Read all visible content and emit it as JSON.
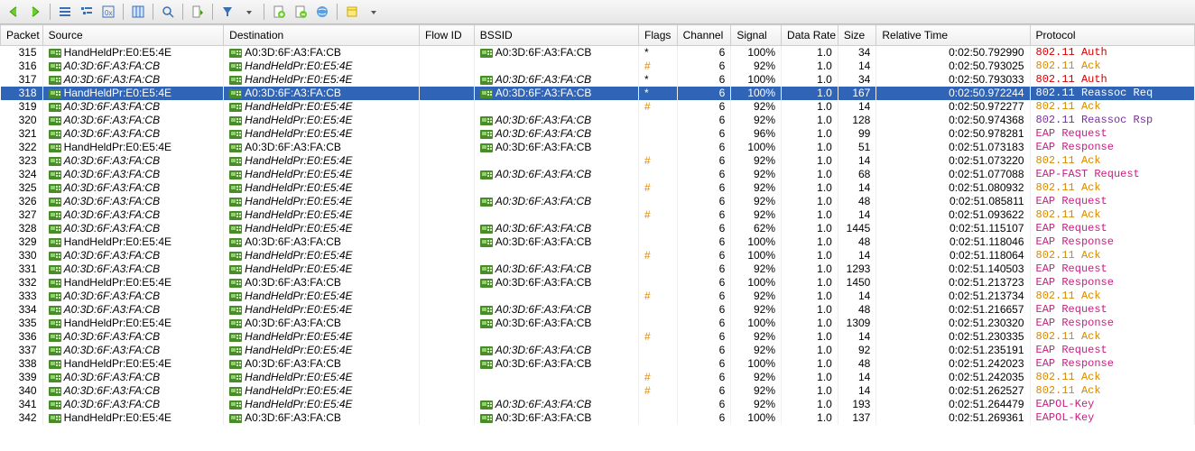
{
  "columns": [
    "Packet",
    "Source",
    "Destination",
    "Flow ID",
    "BSSID",
    "Flags",
    "Channel",
    "Signal",
    "Data Rate",
    "Size",
    "Relative Time",
    "Protocol"
  ],
  "rows": [
    {
      "n": 315,
      "src": "HandHeldPr:E0:E5:4E",
      "dst": "A0:3D:6F:A3:FA:CB",
      "bssid": "A0:3D:6F:A3:FA:CB",
      "flag": "*",
      "ch": 6,
      "sig": "100%",
      "rate": "1.0",
      "size": 34,
      "time": "0:02:50.792990",
      "proto": "802.11 Auth",
      "pclass": "proto-red",
      "italic": false,
      "sel": false
    },
    {
      "n": 316,
      "src": "A0:3D:6F:A3:FA:CB",
      "dst": "HandHeldPr:E0:E5:4E",
      "bssid": "",
      "flag": "#",
      "ch": 6,
      "sig": "92%",
      "rate": "1.0",
      "size": 14,
      "time": "0:02:50.793025",
      "proto": "802.11 Ack",
      "pclass": "proto-orange",
      "italic": true,
      "sel": false
    },
    {
      "n": 317,
      "src": "A0:3D:6F:A3:FA:CB",
      "dst": "HandHeldPr:E0:E5:4E",
      "bssid": "A0:3D:6F:A3:FA:CB",
      "flag": "*",
      "ch": 6,
      "sig": "100%",
      "rate": "1.0",
      "size": 34,
      "time": "0:02:50.793033",
      "proto": "802.11 Auth",
      "pclass": "proto-red",
      "italic": true,
      "sel": false
    },
    {
      "n": 318,
      "src": "HandHeldPr:E0:E5:4E",
      "dst": "A0:3D:6F:A3:FA:CB",
      "bssid": "A0:3D:6F:A3:FA:CB",
      "flag": "*",
      "ch": 6,
      "sig": "100%",
      "rate": "1.0",
      "size": 167,
      "time": "0:02:50.972244",
      "proto": "802.11 Reassoc Req",
      "pclass": "proto-purple",
      "italic": false,
      "sel": true
    },
    {
      "n": 319,
      "src": "A0:3D:6F:A3:FA:CB",
      "dst": "HandHeldPr:E0:E5:4E",
      "bssid": "",
      "flag": "#",
      "ch": 6,
      "sig": "92%",
      "rate": "1.0",
      "size": 14,
      "time": "0:02:50.972277",
      "proto": "802.11 Ack",
      "pclass": "proto-orange",
      "italic": true,
      "sel": false
    },
    {
      "n": 320,
      "src": "A0:3D:6F:A3:FA:CB",
      "dst": "HandHeldPr:E0:E5:4E",
      "bssid": "A0:3D:6F:A3:FA:CB",
      "flag": "",
      "ch": 6,
      "sig": "92%",
      "rate": "1.0",
      "size": 128,
      "time": "0:02:50.974368",
      "proto": "802.11 Reassoc Rsp",
      "pclass": "proto-purple",
      "italic": true,
      "sel": false
    },
    {
      "n": 321,
      "src": "A0:3D:6F:A3:FA:CB",
      "dst": "HandHeldPr:E0:E5:4E",
      "bssid": "A0:3D:6F:A3:FA:CB",
      "flag": "",
      "ch": 6,
      "sig": "96%",
      "rate": "1.0",
      "size": 99,
      "time": "0:02:50.978281",
      "proto": "EAP Request",
      "pclass": "proto-magenta",
      "italic": true,
      "sel": false
    },
    {
      "n": 322,
      "src": "HandHeldPr:E0:E5:4E",
      "dst": "A0:3D:6F:A3:FA:CB",
      "bssid": "A0:3D:6F:A3:FA:CB",
      "flag": "",
      "ch": 6,
      "sig": "100%",
      "rate": "1.0",
      "size": 51,
      "time": "0:02:51.073183",
      "proto": "EAP Response",
      "pclass": "proto-magenta",
      "italic": false,
      "sel": false
    },
    {
      "n": 323,
      "src": "A0:3D:6F:A3:FA:CB",
      "dst": "HandHeldPr:E0:E5:4E",
      "bssid": "",
      "flag": "#",
      "ch": 6,
      "sig": "92%",
      "rate": "1.0",
      "size": 14,
      "time": "0:02:51.073220",
      "proto": "802.11 Ack",
      "pclass": "proto-orange",
      "italic": true,
      "sel": false
    },
    {
      "n": 324,
      "src": "A0:3D:6F:A3:FA:CB",
      "dst": "HandHeldPr:E0:E5:4E",
      "bssid": "A0:3D:6F:A3:FA:CB",
      "flag": "",
      "ch": 6,
      "sig": "92%",
      "rate": "1.0",
      "size": 68,
      "time": "0:02:51.077088",
      "proto": "EAP-FAST Request",
      "pclass": "proto-magenta",
      "italic": true,
      "sel": false
    },
    {
      "n": 325,
      "src": "A0:3D:6F:A3:FA:CB",
      "dst": "HandHeldPr:E0:E5:4E",
      "bssid": "",
      "flag": "#",
      "ch": 6,
      "sig": "92%",
      "rate": "1.0",
      "size": 14,
      "time": "0:02:51.080932",
      "proto": "802.11 Ack",
      "pclass": "proto-orange",
      "italic": true,
      "sel": false
    },
    {
      "n": 326,
      "src": "A0:3D:6F:A3:FA:CB",
      "dst": "HandHeldPr:E0:E5:4E",
      "bssid": "A0:3D:6F:A3:FA:CB",
      "flag": "",
      "ch": 6,
      "sig": "92%",
      "rate": "1.0",
      "size": 48,
      "time": "0:02:51.085811",
      "proto": "EAP Request",
      "pclass": "proto-magenta",
      "italic": true,
      "sel": false
    },
    {
      "n": 327,
      "src": "A0:3D:6F:A3:FA:CB",
      "dst": "HandHeldPr:E0:E5:4E",
      "bssid": "",
      "flag": "#",
      "ch": 6,
      "sig": "92%",
      "rate": "1.0",
      "size": 14,
      "time": "0:02:51.093622",
      "proto": "802.11 Ack",
      "pclass": "proto-orange",
      "italic": true,
      "sel": false
    },
    {
      "n": 328,
      "src": "A0:3D:6F:A3:FA:CB",
      "dst": "HandHeldPr:E0:E5:4E",
      "bssid": "A0:3D:6F:A3:FA:CB",
      "flag": "",
      "ch": 6,
      "sig": "62%",
      "rate": "1.0",
      "size": 1445,
      "time": "0:02:51.115107",
      "proto": "EAP Request",
      "pclass": "proto-magenta",
      "italic": true,
      "sel": false
    },
    {
      "n": 329,
      "src": "HandHeldPr:E0:E5:4E",
      "dst": "A0:3D:6F:A3:FA:CB",
      "bssid": "A0:3D:6F:A3:FA:CB",
      "flag": "",
      "ch": 6,
      "sig": "100%",
      "rate": "1.0",
      "size": 48,
      "time": "0:02:51.118046",
      "proto": "EAP Response",
      "pclass": "proto-magenta",
      "italic": false,
      "sel": false
    },
    {
      "n": 330,
      "src": "A0:3D:6F:A3:FA:CB",
      "dst": "HandHeldPr:E0:E5:4E",
      "bssid": "",
      "flag": "#",
      "ch": 6,
      "sig": "100%",
      "rate": "1.0",
      "size": 14,
      "time": "0:02:51.118064",
      "proto": "802.11 Ack",
      "pclass": "proto-orange",
      "italic": true,
      "sel": false
    },
    {
      "n": 331,
      "src": "A0:3D:6F:A3:FA:CB",
      "dst": "HandHeldPr:E0:E5:4E",
      "bssid": "A0:3D:6F:A3:FA:CB",
      "flag": "",
      "ch": 6,
      "sig": "92%",
      "rate": "1.0",
      "size": 1293,
      "time": "0:02:51.140503",
      "proto": "EAP Request",
      "pclass": "proto-magenta",
      "italic": true,
      "sel": false
    },
    {
      "n": 332,
      "src": "HandHeldPr:E0:E5:4E",
      "dst": "A0:3D:6F:A3:FA:CB",
      "bssid": "A0:3D:6F:A3:FA:CB",
      "flag": "",
      "ch": 6,
      "sig": "100%",
      "rate": "1.0",
      "size": 1450,
      "time": "0:02:51.213723",
      "proto": "EAP Response",
      "pclass": "proto-magenta",
      "italic": false,
      "sel": false
    },
    {
      "n": 333,
      "src": "A0:3D:6F:A3:FA:CB",
      "dst": "HandHeldPr:E0:E5:4E",
      "bssid": "",
      "flag": "#",
      "ch": 6,
      "sig": "92%",
      "rate": "1.0",
      "size": 14,
      "time": "0:02:51.213734",
      "proto": "802.11 Ack",
      "pclass": "proto-orange",
      "italic": true,
      "sel": false
    },
    {
      "n": 334,
      "src": "A0:3D:6F:A3:FA:CB",
      "dst": "HandHeldPr:E0:E5:4E",
      "bssid": "A0:3D:6F:A3:FA:CB",
      "flag": "",
      "ch": 6,
      "sig": "92%",
      "rate": "1.0",
      "size": 48,
      "time": "0:02:51.216657",
      "proto": "EAP Request",
      "pclass": "proto-magenta",
      "italic": true,
      "sel": false
    },
    {
      "n": 335,
      "src": "HandHeldPr:E0:E5:4E",
      "dst": "A0:3D:6F:A3:FA:CB",
      "bssid": "A0:3D:6F:A3:FA:CB",
      "flag": "",
      "ch": 6,
      "sig": "100%",
      "rate": "1.0",
      "size": 1309,
      "time": "0:02:51.230320",
      "proto": "EAP Response",
      "pclass": "proto-magenta",
      "italic": false,
      "sel": false
    },
    {
      "n": 336,
      "src": "A0:3D:6F:A3:FA:CB",
      "dst": "HandHeldPr:E0:E5:4E",
      "bssid": "",
      "flag": "#",
      "ch": 6,
      "sig": "92%",
      "rate": "1.0",
      "size": 14,
      "time": "0:02:51.230335",
      "proto": "802.11 Ack",
      "pclass": "proto-orange",
      "italic": true,
      "sel": false
    },
    {
      "n": 337,
      "src": "A0:3D:6F:A3:FA:CB",
      "dst": "HandHeldPr:E0:E5:4E",
      "bssid": "A0:3D:6F:A3:FA:CB",
      "flag": "",
      "ch": 6,
      "sig": "92%",
      "rate": "1.0",
      "size": 92,
      "time": "0:02:51.235191",
      "proto": "EAP Request",
      "pclass": "proto-magenta",
      "italic": true,
      "sel": false
    },
    {
      "n": 338,
      "src": "HandHeldPr:E0:E5:4E",
      "dst": "A0:3D:6F:A3:FA:CB",
      "bssid": "A0:3D:6F:A3:FA:CB",
      "flag": "",
      "ch": 6,
      "sig": "100%",
      "rate": "1.0",
      "size": 48,
      "time": "0:02:51.242023",
      "proto": "EAP Response",
      "pclass": "proto-magenta",
      "italic": false,
      "sel": false
    },
    {
      "n": 339,
      "src": "A0:3D:6F:A3:FA:CB",
      "dst": "HandHeldPr:E0:E5:4E",
      "bssid": "",
      "flag": "#",
      "ch": 6,
      "sig": "92%",
      "rate": "1.0",
      "size": 14,
      "time": "0:02:51.242035",
      "proto": "802.11 Ack",
      "pclass": "proto-orange",
      "italic": true,
      "sel": false
    },
    {
      "n": 340,
      "src": "A0:3D:6F:A3:FA:CB",
      "dst": "HandHeldPr:E0:E5:4E",
      "bssid": "",
      "flag": "#",
      "ch": 6,
      "sig": "92%",
      "rate": "1.0",
      "size": 14,
      "time": "0:02:51.262527",
      "proto": "802.11 Ack",
      "pclass": "proto-orange",
      "italic": true,
      "sel": false
    },
    {
      "n": 341,
      "src": "A0:3D:6F:A3:FA:CB",
      "dst": "HandHeldPr:E0:E5:4E",
      "bssid": "A0:3D:6F:A3:FA:CB",
      "flag": "",
      "ch": 6,
      "sig": "92%",
      "rate": "1.0",
      "size": 193,
      "time": "0:02:51.264479",
      "proto": "EAPOL-Key",
      "pclass": "proto-magenta",
      "italic": true,
      "sel": false
    },
    {
      "n": 342,
      "src": "HandHeldPr:E0:E5:4E",
      "dst": "A0:3D:6F:A3:FA:CB",
      "bssid": "A0:3D:6F:A3:FA:CB",
      "flag": "",
      "ch": 6,
      "sig": "100%",
      "rate": "1.0",
      "size": 137,
      "time": "0:02:51.269361",
      "proto": "EAPOL-Key",
      "pclass": "proto-magenta",
      "italic": false,
      "sel": false
    }
  ]
}
